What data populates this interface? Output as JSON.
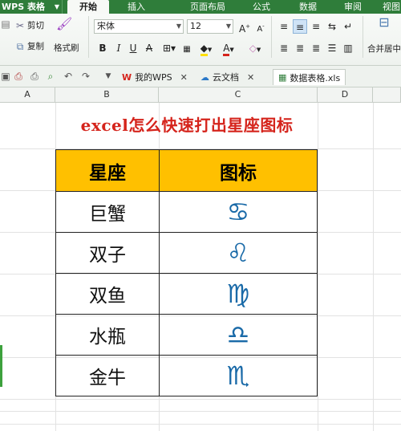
{
  "app": {
    "name": "WPS 表格"
  },
  "tabs": [
    {
      "label": "开始",
      "active": true
    },
    {
      "label": "插入",
      "active": false
    },
    {
      "label": "页面布局",
      "active": false
    },
    {
      "label": "公式",
      "active": false
    },
    {
      "label": "数据",
      "active": false
    },
    {
      "label": "审阅",
      "active": false
    },
    {
      "label": "视图",
      "active": false
    }
  ],
  "ribbon": {
    "cut": "剪切",
    "copy": "复制",
    "format_painter": "格式刷",
    "font_name": "宋体",
    "font_size": "12",
    "bold": "B",
    "italic": "I",
    "underline": "U",
    "merge_center": "合并居中"
  },
  "doc_tabs": [
    {
      "label": "我的WPS"
    },
    {
      "label": "云文档"
    },
    {
      "label": "数据表格.xls"
    }
  ],
  "columns": [
    "A",
    "B",
    "C",
    "D"
  ],
  "sheet": {
    "title": "excel怎么快速打出星座图标",
    "headers": {
      "name": "星座",
      "icon": "图标"
    },
    "rows": [
      {
        "name": "巨蟹",
        "symbol": "♋"
      },
      {
        "name": "双子",
        "symbol": "♌"
      },
      {
        "name": "双鱼",
        "symbol": "♍"
      },
      {
        "name": "水瓶",
        "symbol": "♎"
      },
      {
        "name": "金牛",
        "symbol": "♏"
      }
    ]
  },
  "colors": {
    "title": "#d5241c",
    "header_fill": "#ffc000",
    "symbol": "#1a6aa8",
    "ribbon_green": "#2f7d3a"
  }
}
